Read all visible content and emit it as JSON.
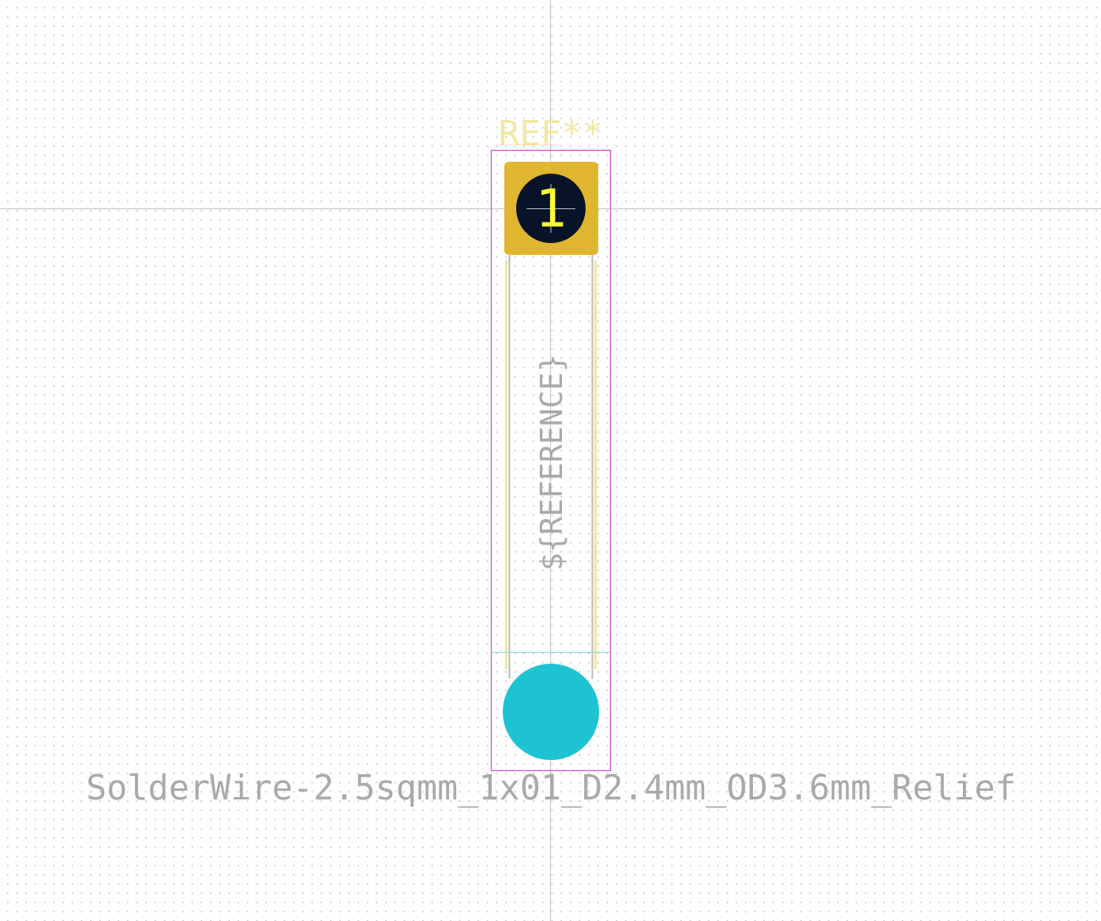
{
  "footprint": {
    "reference": "REF**",
    "user_text": "${REFERENCE}",
    "value": "SolderWire-2.5sqmm_1x01_D2.4mm_OD3.6mm_Relief",
    "pad_number": "1"
  },
  "colors": {
    "pad": "#e0b52f",
    "drill": "#071428",
    "silkscreen": "#efe7a0",
    "fab": "#a9a9a9",
    "courtyard": "#d84fd1",
    "relief_hole": "#1ec3d2",
    "grid_dot": "#c4c4c4",
    "axis": "#c6c6c6",
    "pad_number": "#ffff33"
  }
}
